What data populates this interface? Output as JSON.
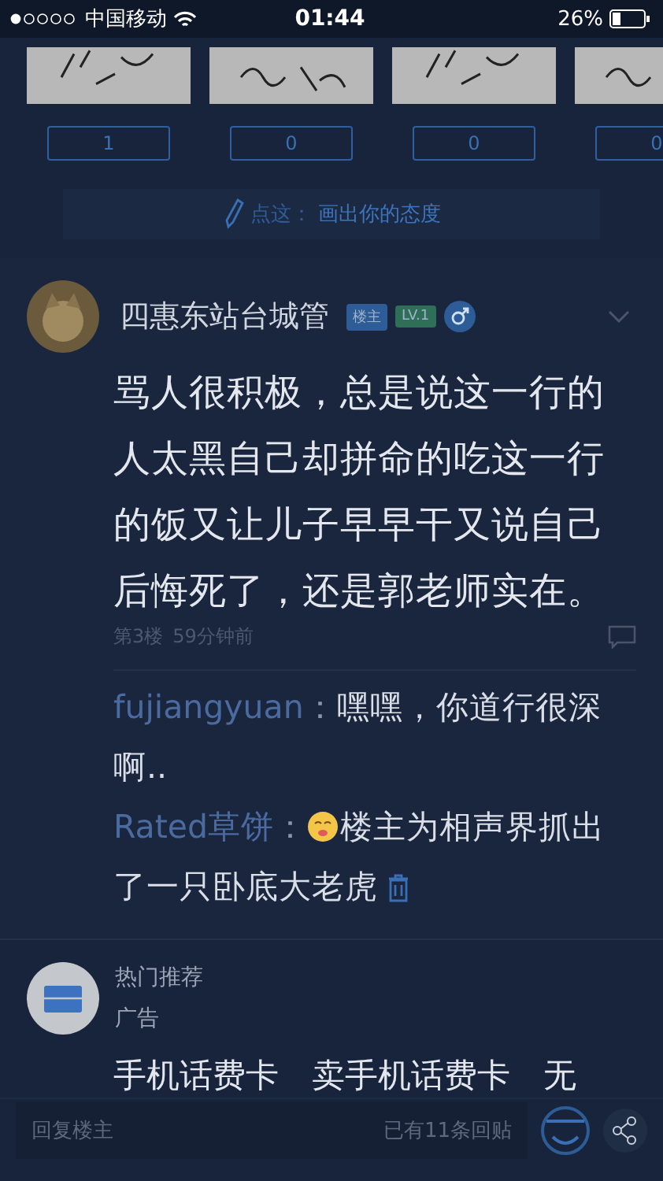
{
  "status_bar": {
    "carrier": "中国移动",
    "time": "01:44",
    "battery": "26%"
  },
  "stickers": [
    {
      "kind": "picture",
      "count": "1"
    },
    {
      "kind": "picture",
      "count": "0"
    },
    {
      "kind": "picture",
      "count": "0"
    },
    {
      "kind": "picture",
      "count": "0"
    }
  ],
  "draw_prompt": {
    "label": "点这：",
    "text": "画出你的态度"
  },
  "post": {
    "author": "四惠东站台城管",
    "badges": [
      {
        "label": "楼主",
        "color": "#2d5c97"
      },
      {
        "label": "LV.1",
        "color": "#2f6f58"
      }
    ],
    "content": "骂人很积极，总是说这一行的人太黑自己却拼命的吃这一行的饭又让儿子早早干又说自己后悔死了，还是郭老师实在。",
    "floor": "第3楼",
    "time": "59分钟前"
  },
  "replies": [
    {
      "user": "fujiangyuan",
      "separator": "：",
      "text": "嘿嘿，你道行很深啊..",
      "has_emoji": false,
      "deletable": false
    },
    {
      "user": "Rated草饼",
      "separator": "：",
      "text": "楼主为相声界抓出了一只卧底大老虎",
      "has_emoji": true,
      "deletable": true
    }
  ],
  "ad": {
    "title": "热门推荐",
    "label": "广告",
    "text": "手机话费卡　卖手机话费卡　无"
  },
  "reply_bar": {
    "placeholder": "回复楼主",
    "count": "已有11条回贴"
  }
}
